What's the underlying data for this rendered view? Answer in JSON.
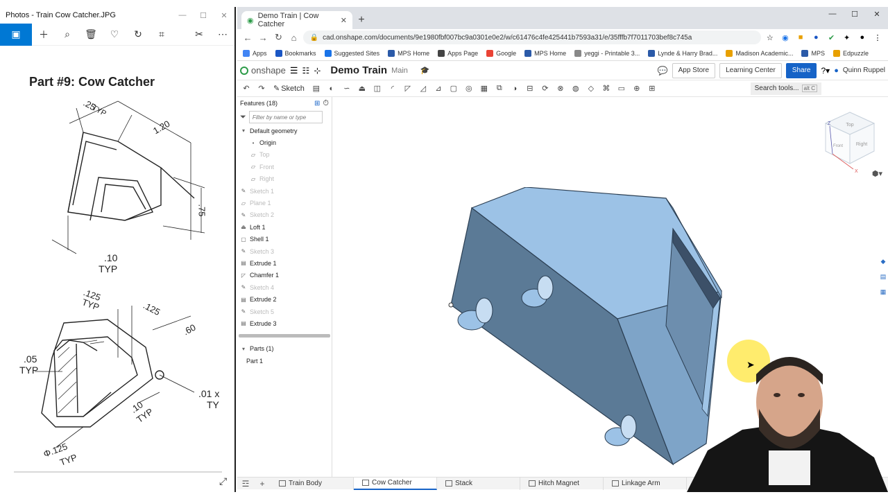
{
  "photos": {
    "window_title": "Photos - Train Cow Catcher.JPG",
    "drawing_title": "Part #9: Cow Catcher",
    "dimensions": {
      "d1": ".25",
      "d1_typ": "TYP",
      "d2": "1.20",
      "d3": ".75",
      "d4": ".10",
      "d4_typ": "TYP",
      "d5": ".125",
      "d5_typ": "TYP",
      "d6": ".125",
      "d7": ".60",
      "d8": ".05",
      "d8_typ": "TYP",
      "d9": ".10",
      "d9_typ": "TYP",
      "d10": ".01 x",
      "d10_typ": "TY",
      "d11": "Φ.125",
      "d11_typ": "TYP"
    }
  },
  "browser": {
    "tab_title": "Demo Train | Cow Catcher",
    "url": "cad.onshape.com/documents/9e1980fbf007bc9a0301e0e2/w/c61476c4fe425441b7593a31/e/35fffb7f7011703bef8c745a",
    "bookmarks": [
      {
        "label": "Apps",
        "color": "#4285f4"
      },
      {
        "label": "Bookmarks",
        "color": "#1a56c4"
      },
      {
        "label": "Suggested Sites",
        "color": "#1a73e8"
      },
      {
        "label": "MPS Home",
        "color": "#2b5aa8"
      },
      {
        "label": "Apps Page",
        "color": "#444444"
      },
      {
        "label": "Google",
        "color": "#ea4335"
      },
      {
        "label": "MPS Home",
        "color": "#2b5aa8"
      },
      {
        "label": "yeggi - Printable 3...",
        "color": "#888888"
      },
      {
        "label": "Lynde & Harry Brad...",
        "color": "#2b5aa8"
      },
      {
        "label": "Madison Academic...",
        "color": "#e8a000"
      },
      {
        "label": "MPS",
        "color": "#2b5aa8"
      },
      {
        "label": "Edpuzzle",
        "color": "#e8a000"
      }
    ]
  },
  "onshape": {
    "logo_text": "onshape",
    "doc_name": "Demo Train",
    "branch": "Main",
    "app_store": "App Store",
    "learning_center": "Learning Center",
    "share": "Share",
    "user_name": "Quinn Ruppel",
    "sketch_label": "Sketch",
    "search_tools": "Search tools...",
    "search_shortcut": "alt C",
    "features_header": "Features (18)",
    "filter_placeholder": "Filter by name or type",
    "default_geometry": "Default geometry",
    "features": [
      {
        "label": "Origin",
        "muted": false,
        "indent": true,
        "icon": "origin-icon"
      },
      {
        "label": "Top",
        "muted": true,
        "indent": true,
        "icon": "plane-icon"
      },
      {
        "label": "Front",
        "muted": true,
        "indent": true,
        "icon": "plane-icon"
      },
      {
        "label": "Right",
        "muted": true,
        "indent": true,
        "icon": "plane-icon"
      },
      {
        "label": "Sketch 1",
        "muted": true,
        "indent": false,
        "icon": "sketch-icon"
      },
      {
        "label": "Plane 1",
        "muted": true,
        "indent": false,
        "icon": "plane-icon"
      },
      {
        "label": "Sketch 2",
        "muted": true,
        "indent": false,
        "icon": "sketch-icon"
      },
      {
        "label": "Loft 1",
        "muted": false,
        "indent": false,
        "icon": "loft-icon"
      },
      {
        "label": "Shell 1",
        "muted": false,
        "indent": false,
        "icon": "shell-icon"
      },
      {
        "label": "Sketch 3",
        "muted": true,
        "indent": false,
        "icon": "sketch-icon"
      },
      {
        "label": "Extrude 1",
        "muted": false,
        "indent": false,
        "icon": "extrude-icon"
      },
      {
        "label": "Chamfer 1",
        "muted": false,
        "indent": false,
        "icon": "chamfer-icon"
      },
      {
        "label": "Sketch 4",
        "muted": true,
        "indent": false,
        "icon": "sketch-icon"
      },
      {
        "label": "Extrude 2",
        "muted": false,
        "indent": false,
        "icon": "extrude-icon"
      },
      {
        "label": "Sketch 5",
        "muted": true,
        "indent": false,
        "icon": "sketch-icon"
      },
      {
        "label": "Extrude 3",
        "muted": false,
        "indent": false,
        "icon": "extrude-icon"
      }
    ],
    "parts_header": "Parts (1)",
    "parts": [
      "Part 1"
    ],
    "viewcube": {
      "top": "Top",
      "front": "Front",
      "right": "Right"
    },
    "tabs": [
      {
        "label": "Train Body",
        "active": false
      },
      {
        "label": "Cow Catcher",
        "active": true
      },
      {
        "label": "Stack",
        "active": false
      },
      {
        "label": "Hitch Magnet",
        "active": false
      },
      {
        "label": "Linkage Arm",
        "active": false
      }
    ],
    "colors": {
      "accent": "#1663c7",
      "model_top": "#9cc2e6",
      "model_side": "#5b7a96",
      "model_front": "#7ea4c8"
    }
  }
}
